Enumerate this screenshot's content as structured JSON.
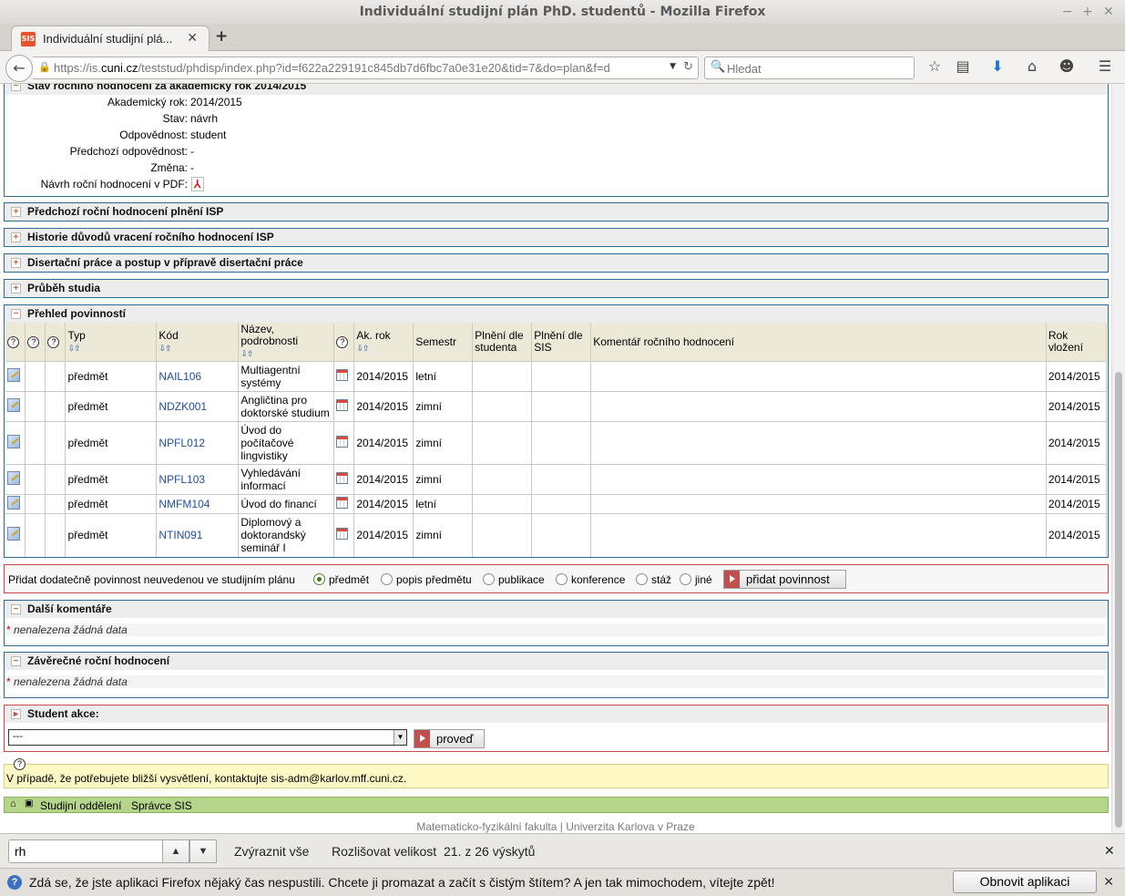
{
  "window": {
    "title": "Individuální studijní plán PhD. studentů - Mozilla Firefox"
  },
  "tab": {
    "title": "Individuální studijní plá...",
    "favicon_text": "SIS"
  },
  "nav": {
    "url_prefix": "https://is.",
    "url_domain": "cuni.cz",
    "url_rest": "/teststud/phdisp/index.php?id=f622a229191c845db7d6fbc7a0e31e20&tid=7&do=plan&f=d",
    "search_placeholder": "Hledat"
  },
  "status_section": {
    "title": "Stav ročního hodnocení za akademický rok 2014/2015",
    "rows": [
      {
        "label": "Akademický rok:",
        "value": "2014/2015"
      },
      {
        "label": "Stav:",
        "value": "návrh"
      },
      {
        "label": "Odpovědnost:",
        "value": "student"
      },
      {
        "label": "Předchozí odpovědnost:",
        "value": "-"
      },
      {
        "label": "Změna:",
        "value": "-"
      },
      {
        "label": "Návrh roční hodnocení v PDF:",
        "value": ""
      }
    ]
  },
  "collapsed_sections": [
    "Předchozí roční hodnocení plnění ISP",
    "Historie důvodů vracení ročního hodnocení ISP",
    "Disertační práce a postup v přípravě disertační práce",
    "Průběh studia"
  ],
  "obligations": {
    "title": "Přehled povinností",
    "headers": {
      "typ": "Typ",
      "kod": "Kód",
      "nazev": "Název, podrobnosti",
      "akrok": "Ak. rok",
      "semestr": "Semestr",
      "plneni_student": "Plnění dle studenta",
      "plneni_sis": "Plnění dle SIS",
      "komentar": "Komentář ročního hodnocení",
      "vlozeni": "Rok vložení"
    },
    "sort_arrows": "⇩⇧",
    "rows": [
      {
        "typ": "předmět",
        "kod": "NAIL106",
        "nazev": "Multiagentní systémy",
        "akrok": "2014/2015",
        "semestr": "letní",
        "vlozeni": "2014/2015"
      },
      {
        "typ": "předmět",
        "kod": "NDZK001",
        "nazev": "Angličtina pro doktorské studium",
        "akrok": "2014/2015",
        "semestr": "zimní",
        "vlozeni": "2014/2015"
      },
      {
        "typ": "předmět",
        "kod": "NPFL012",
        "nazev": "Úvod do počítačové lingvistiky",
        "akrok": "2014/2015",
        "semestr": "zimní",
        "vlozeni": "2014/2015"
      },
      {
        "typ": "předmět",
        "kod": "NPFL103",
        "nazev": "Vyhledávání informací",
        "akrok": "2014/2015",
        "semestr": "zimní",
        "vlozeni": "2014/2015"
      },
      {
        "typ": "předmět",
        "kod": "NMFM104",
        "nazev": "Úvod do financí",
        "akrok": "2014/2015",
        "semestr": "letní",
        "vlozeni": "2014/2015"
      },
      {
        "typ": "předmět",
        "kod": "NTIN091",
        "nazev": "Diplomový a doktorandský seminář I",
        "akrok": "2014/2015",
        "semestr": "zimní",
        "vlozeni": "2014/2015"
      }
    ]
  },
  "add_obligation": {
    "label": "Přidat dodatečně povinnost neuvedenou ve studijním plánu",
    "options": [
      "předmět",
      "popis předmětu",
      "publikace",
      "konference",
      "stáž",
      "jiné"
    ],
    "selected": "předmět",
    "button": "přidat povinnost"
  },
  "other_comments": {
    "title": "Další komentáře",
    "star": "*",
    "empty": "nenalezena žádná data"
  },
  "final_eval": {
    "title": "Závěrečné roční hodnocení",
    "star": "*",
    "empty": "nenalezena žádná data"
  },
  "student_actions": {
    "title": "Student akce:",
    "select_value": "---",
    "button": "proveď"
  },
  "help": {
    "text": "V případě, že potřebujete bližší vysvětlení, kontaktujte sis-adm@karlov.mff.cuni.cz."
  },
  "footer_nav": {
    "item1": "Studijní oddělení",
    "item2": "Správce SIS"
  },
  "footer": {
    "faculty": "Matematicko-fyzikální fakulta",
    "separator": "|",
    "university": "Univerzita Karlova v Praze"
  },
  "findbar": {
    "query": "rh",
    "highlight_all": "Zvýraznit vše",
    "match_case": "Rozlišovat velikost",
    "result": "21. z 26 výskytů"
  },
  "notification": {
    "message": "Zdá se, že jste aplikaci Firefox nějaký čas nespustili. Chcete ji promazat a začít s čistým štítem? A jen tak mimochodem, vítejte zpět!",
    "button": "Obnovit aplikaci Firefox..."
  },
  "colors": {
    "section_border": "#2d6a8c",
    "action_border": "#c84b4b",
    "help_bg": "#fdf8c4",
    "footer_nav_bg": "#b5d68a",
    "table_header_bg": "#ece9d8"
  }
}
